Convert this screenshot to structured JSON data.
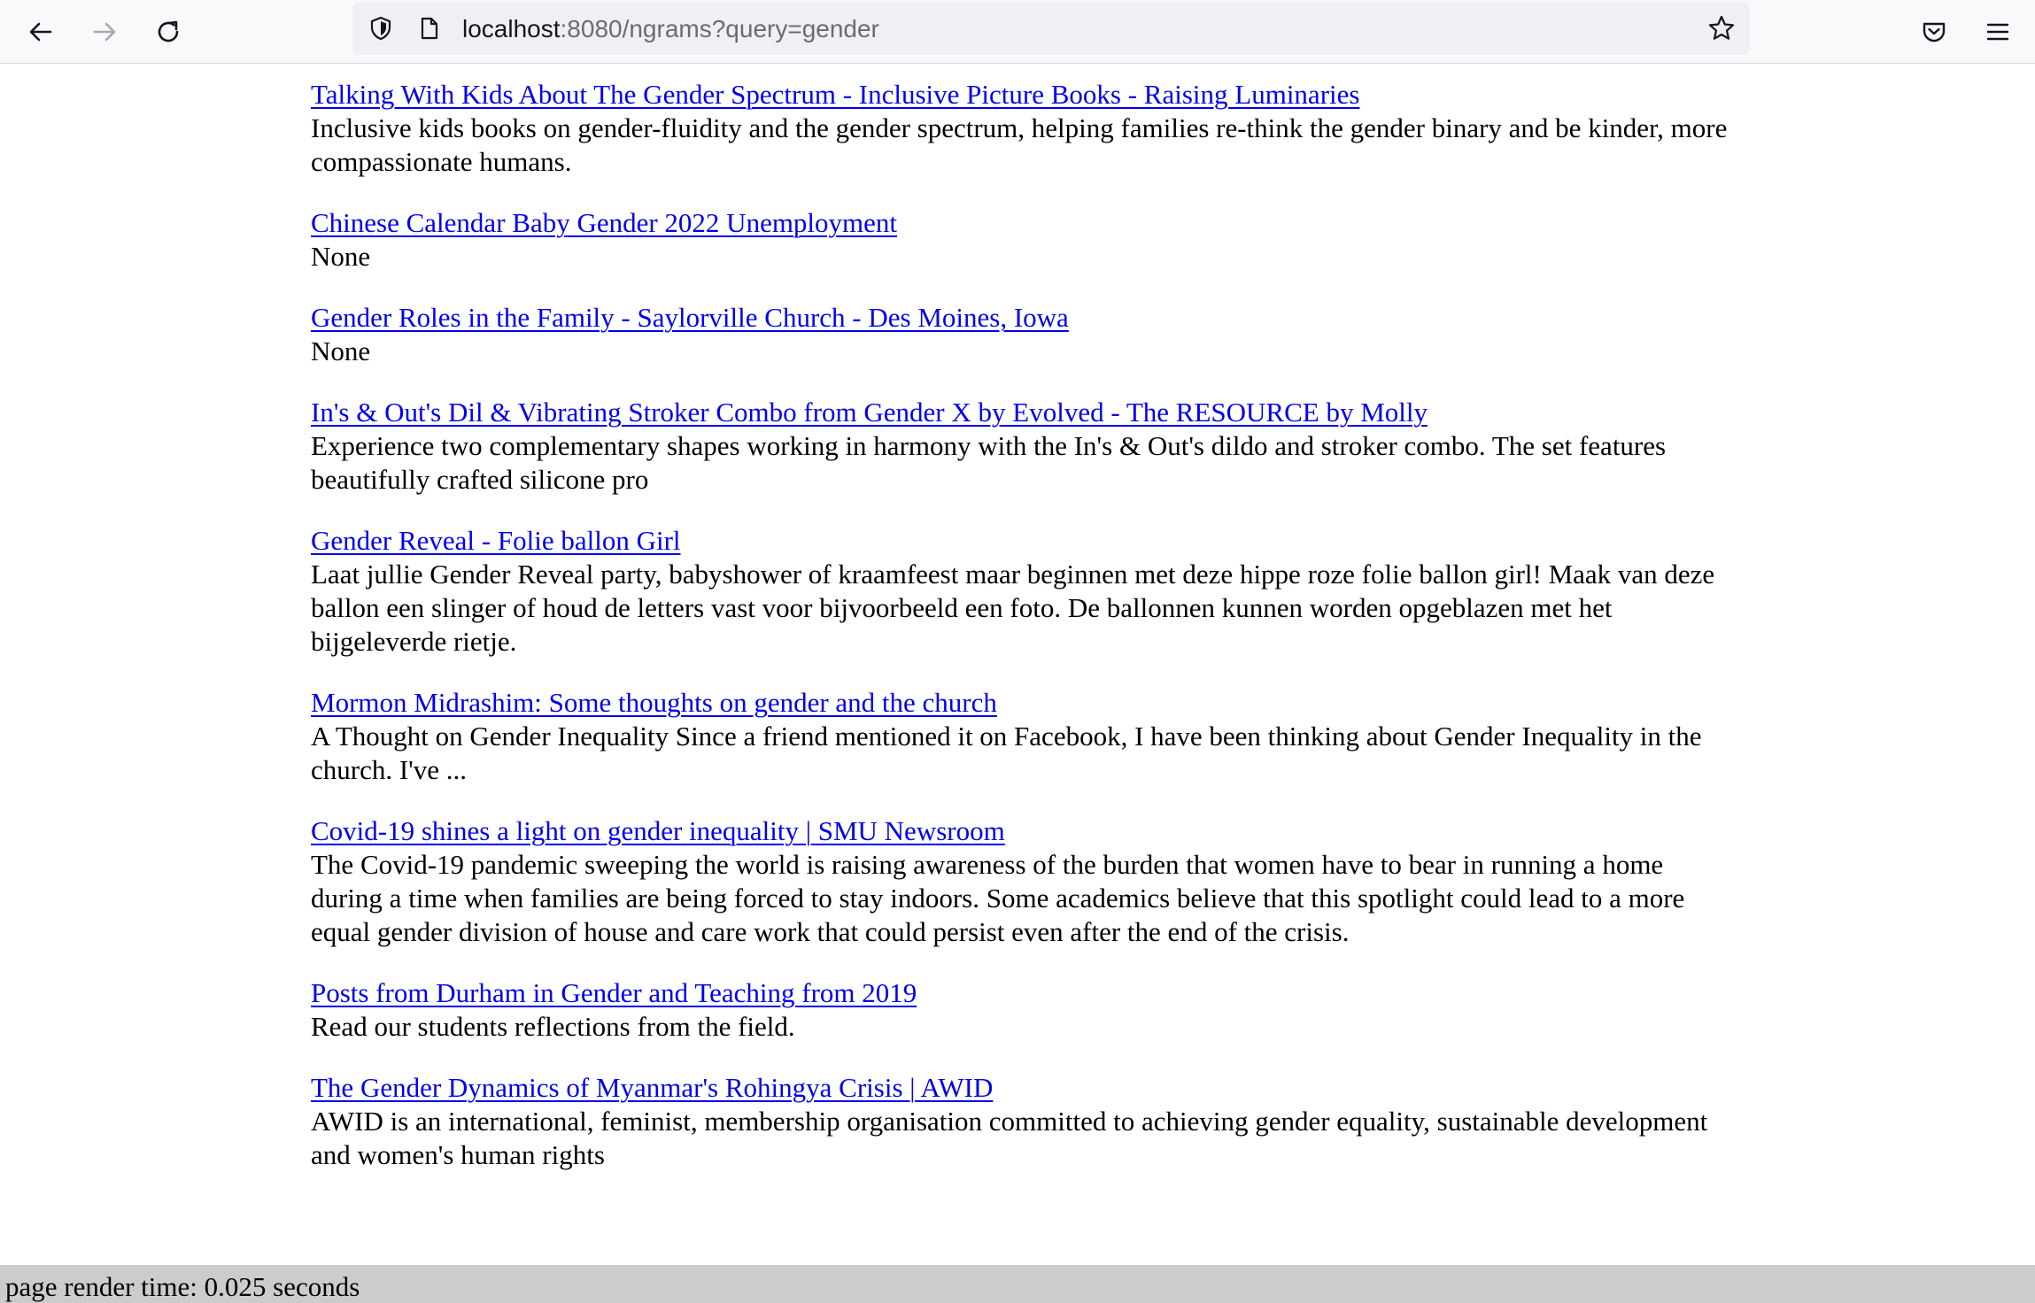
{
  "browser": {
    "url_host": "localhost",
    "url_rest": ":8080/ngrams?query=gender",
    "icons": {
      "back": "arrow-left-icon",
      "forward": "arrow-right-icon",
      "reload": "reload-icon",
      "shield": "shield-icon",
      "page": "page-icon",
      "bookmark": "star-icon",
      "pocket": "pocket-icon",
      "menu": "hamburger-menu-icon"
    }
  },
  "results": [
    {
      "title": "Talking With Kids About The Gender Spectrum - Inclusive Picture Books - Raising Luminaries",
      "snippet": "Inclusive kids books on gender-fluidity and the gender spectrum, helping families re-think the gender binary and be kinder, more compassionate humans."
    },
    {
      "title": "Chinese Calendar Baby Gender 2022 Unemployment",
      "snippet": "None"
    },
    {
      "title": "Gender Roles in the Family - Saylorville Church - Des Moines, Iowa",
      "snippet": "None"
    },
    {
      "title": "In's & Out's Dil & Vibrating Stroker Combo from Gender X by Evolved - The RESOURCE by Molly",
      "snippet": "Experience two complementary shapes working in harmony with the In's & Out's dildo and stroker combo. The set features beautifully crafted silicone pro"
    },
    {
      "title": "Gender Reveal - Folie ballon Girl",
      "snippet": "Laat jullie Gender Reveal party, babyshower of kraamfeest maar beginnen met deze hippe roze folie ballon girl! Maak van deze ballon een slinger of houd de letters vast voor bijvoorbeeld een foto. De ballonnen kunnen worden opgeblazen met het bijgeleverde rietje."
    },
    {
      "title": "Mormon Midrashim: Some thoughts on gender and the church",
      "snippet": "A Thought on Gender Inequality Since a friend mentioned it on Facebook, I have been thinking about Gender Inequality in the church. I've ..."
    },
    {
      "title": "Covid-19 shines a light on gender inequality | SMU Newsroom",
      "snippet": "The Covid-19 pandemic sweeping the world is raising awareness of the burden that women have to bear in running a home during a time when families are being forced to stay indoors. Some academics believe that this spotlight could lead to a more equal gender division of house and care work that could persist even after the end of the crisis."
    },
    {
      "title": "Posts from Durham in Gender and Teaching from 2019",
      "snippet": "Read our students reflections from the field."
    },
    {
      "title": "The Gender Dynamics of Myanmar's Rohingya Crisis | AWID",
      "snippet": "AWID is an international, feminist, membership organisation committed to achieving gender equality, sustainable development and women's human rights"
    }
  ],
  "footer": {
    "render_time": "page render time: 0.025 seconds"
  },
  "colors": {
    "link": "#0000ee",
    "footer_bg": "#cccccc"
  }
}
